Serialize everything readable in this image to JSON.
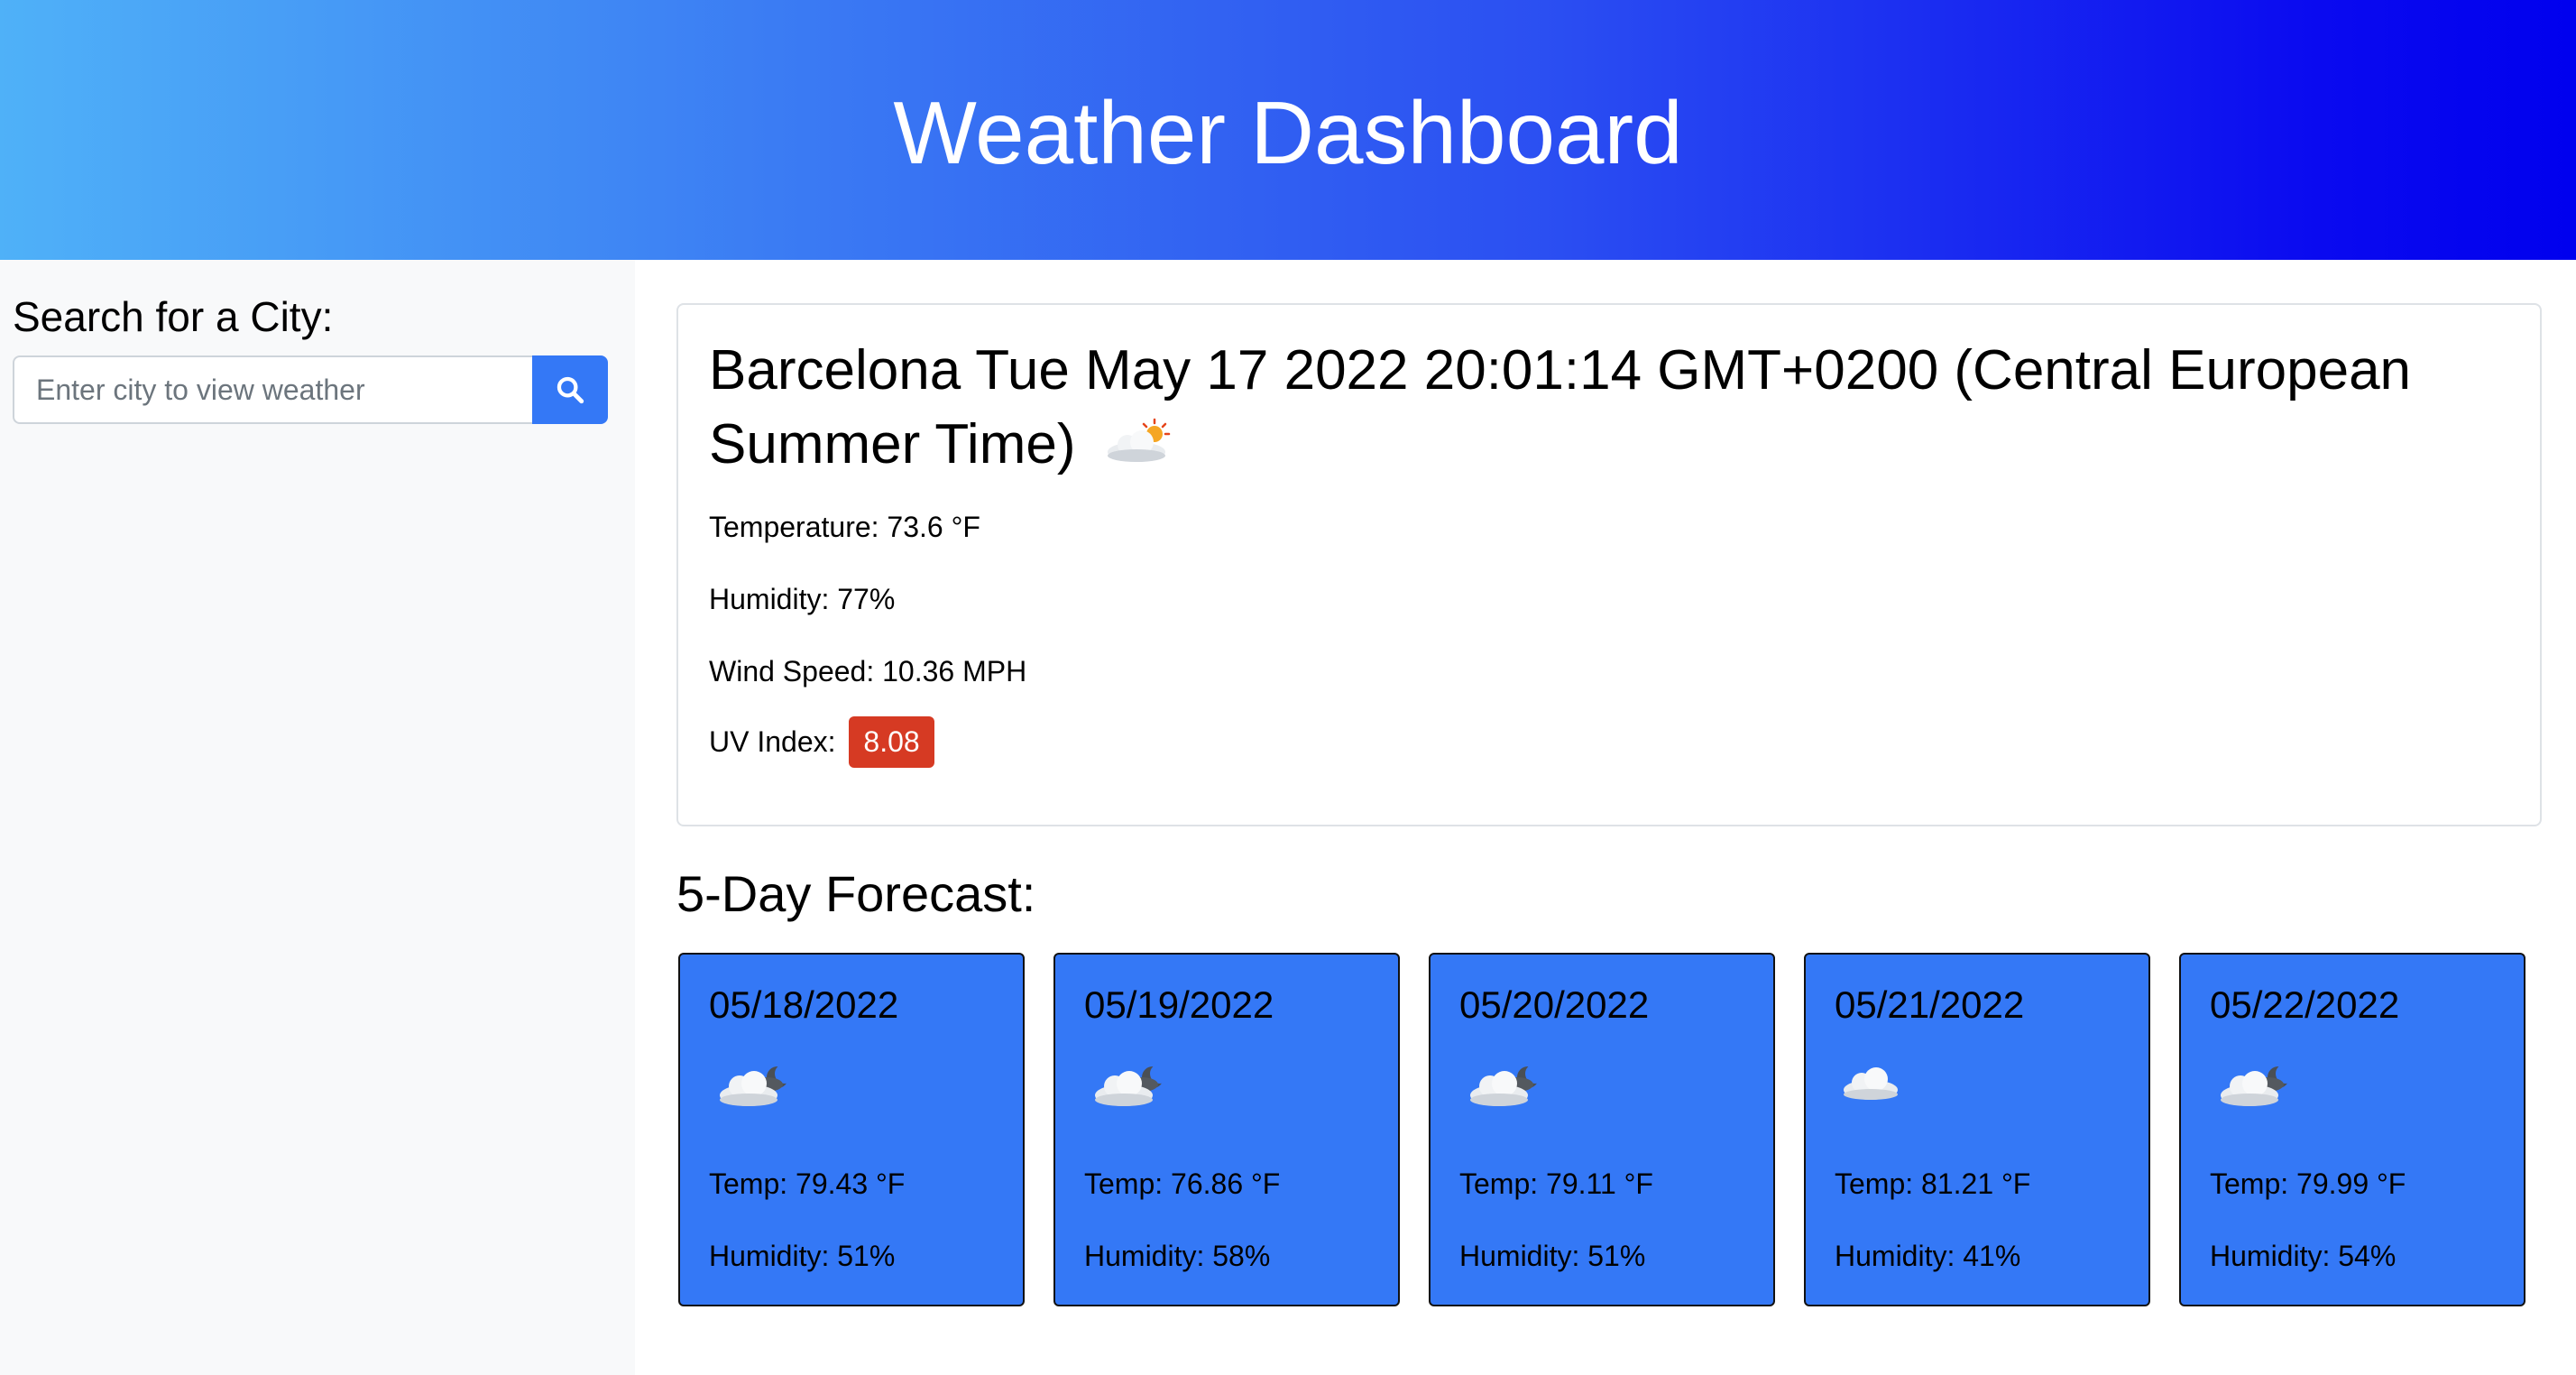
{
  "header": {
    "title": "Weather Dashboard"
  },
  "sidebar": {
    "heading": "Search for a City:",
    "search": {
      "placeholder": "Enter city to view weather",
      "value": ""
    },
    "search_button_icon": "search-icon"
  },
  "current": {
    "title": "Barcelona Tue May 17 2022 20:01:14 GMT+0200 (Central European Summer Time)",
    "icon": "cloud-sun-icon",
    "temperature": "Temperature: 73.6 °F",
    "humidity": "Humidity: 77%",
    "wind": "Wind Speed: 10.36 MPH",
    "uv_label": "UV Index:",
    "uv_value": "8.08",
    "uv_color": "#d63a23"
  },
  "forecast": {
    "title": "5-Day Forecast:",
    "card_color": "#3478f6",
    "days": [
      {
        "date": "05/18/2022",
        "icon": "cloud-moon-icon",
        "temp": "Temp: 79.43 °F",
        "humidity": "Humidity: 51%"
      },
      {
        "date": "05/19/2022",
        "icon": "cloud-moon-icon",
        "temp": "Temp: 76.86 °F",
        "humidity": "Humidity: 58%"
      },
      {
        "date": "05/20/2022",
        "icon": "cloud-moon-icon",
        "temp": "Temp: 79.11 °F",
        "humidity": "Humidity: 51%"
      },
      {
        "date": "05/21/2022",
        "icon": "cloud-icon",
        "temp": "Temp: 81.21 °F",
        "humidity": "Humidity: 41%"
      },
      {
        "date": "05/22/2022",
        "icon": "cloud-moon-icon",
        "temp": "Temp: 79.99 °F",
        "humidity": "Humidity: 54%"
      }
    ]
  }
}
